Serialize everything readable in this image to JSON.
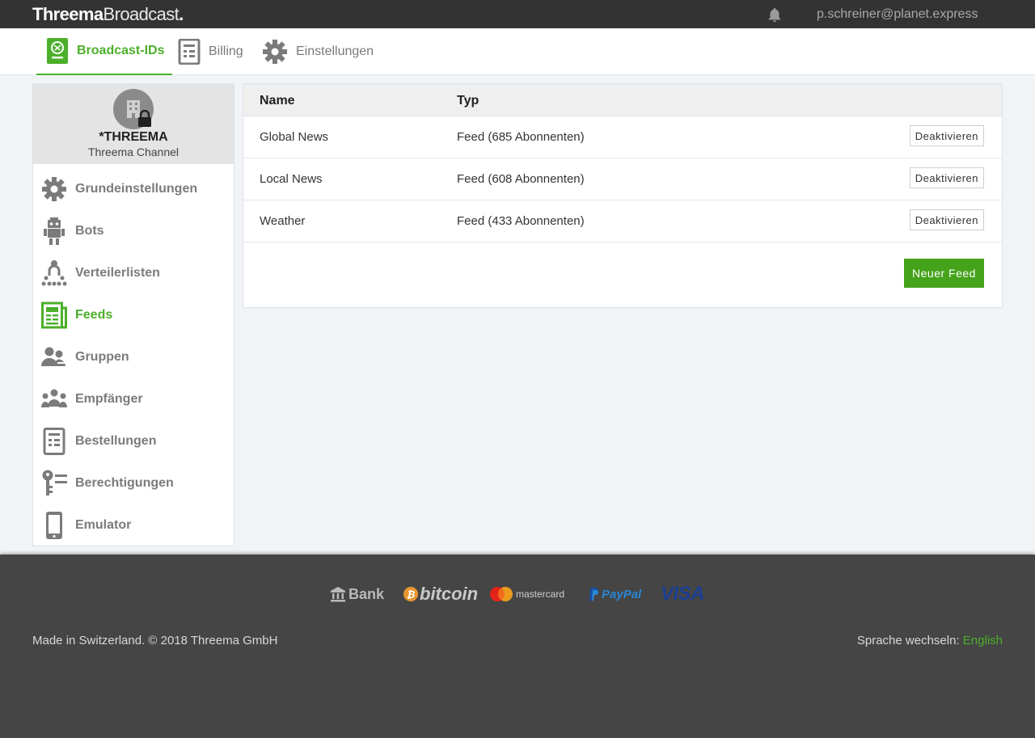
{
  "header": {
    "logo_bold": "Threema",
    "logo_light": "Broadcast",
    "logo_dot": ".",
    "user_email": "p.schreiner@planet.express"
  },
  "tabs": [
    {
      "label": "Broadcast-IDs",
      "icon": "broadcast-id-icon",
      "active": true
    },
    {
      "label": "Billing",
      "icon": "billing-icon",
      "active": false
    },
    {
      "label": "Einstellungen",
      "icon": "gear-icon",
      "active": false
    }
  ],
  "profile": {
    "name": "*THREEMA",
    "subtitle": "Threema Channel"
  },
  "sidebar": {
    "items": [
      {
        "label": "Grundeinstellungen",
        "icon": "gear-icon"
      },
      {
        "label": "Bots",
        "icon": "robot-icon"
      },
      {
        "label": "Verteilerlisten",
        "icon": "distribution-list-icon"
      },
      {
        "label": "Feeds",
        "icon": "feed-icon",
        "active": true
      },
      {
        "label": "Gruppen",
        "icon": "group-icon"
      },
      {
        "label": "Empfänger",
        "icon": "recipients-icon"
      },
      {
        "label": "Bestellungen",
        "icon": "orders-icon"
      },
      {
        "label": "Berechtigungen",
        "icon": "key-icon"
      },
      {
        "label": "Emulator",
        "icon": "phone-icon"
      }
    ]
  },
  "table": {
    "columns": [
      "Name",
      "Typ"
    ],
    "rows": [
      {
        "name": "Global News",
        "type": "Feed (685 Abonnenten)",
        "action": "Deaktivieren"
      },
      {
        "name": "Local News",
        "type": "Feed (608 Abonnenten)",
        "action": "Deaktivieren"
      },
      {
        "name": "Weather",
        "type": "Feed (433 Abonnenten)",
        "action": "Deaktivieren"
      }
    ],
    "new_button": "Neuer Feed"
  },
  "footer": {
    "payments": [
      "Bank",
      "bitcoin",
      "mastercard",
      "PayPal",
      "VISA"
    ],
    "copyright": "Made in Switzerland. © 2018 Threema GmbH",
    "language_prefix": "Sprache wechseln:",
    "language_link": "English"
  },
  "colors": {
    "accent": "#4caf2a",
    "topbar": "#333333",
    "footer": "#454545"
  }
}
